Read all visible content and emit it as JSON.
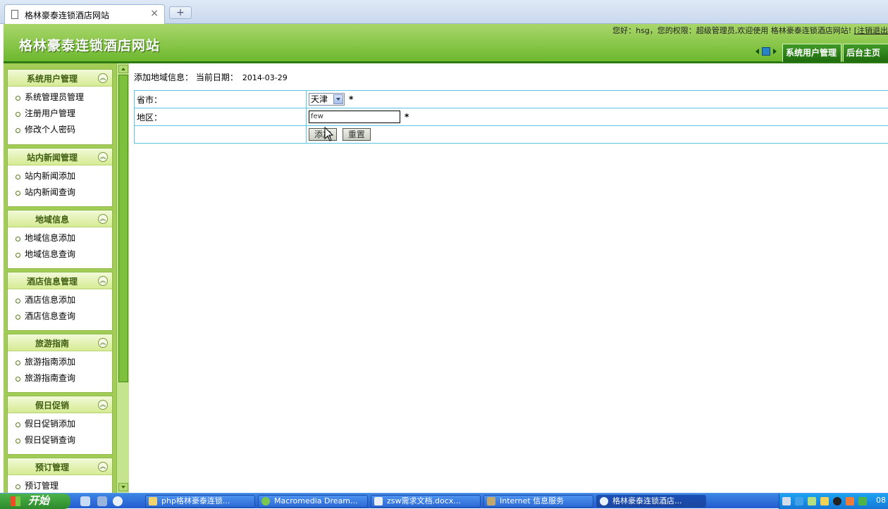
{
  "browser": {
    "tab_title": "格林豪泰连锁酒店网站",
    "close_glyph": "×",
    "new_tab_glyph": "+"
  },
  "header": {
    "site_title": "格林豪泰连锁酒店网站",
    "greeting": "您好：hsg，您的权限：超级管理员,欢迎使用 格林豪泰连锁酒店网站!",
    "logout": "[注销退出",
    "nav_tabs": [
      "系统用户管理",
      "后台主页"
    ]
  },
  "sidebar": {
    "panels": [
      {
        "title": "系统用户管理",
        "items": [
          "系统管理员管理",
          "注册用户管理",
          "修改个人密码"
        ]
      },
      {
        "title": "站内新闻管理",
        "items": [
          "站内新闻添加",
          "站内新闻查询"
        ]
      },
      {
        "title": "地域信息",
        "items": [
          "地域信息添加",
          "地域信息查询"
        ]
      },
      {
        "title": "酒店信息管理",
        "items": [
          "酒店信息添加",
          "酒店信息查询"
        ]
      },
      {
        "title": "旅游指南",
        "items": [
          "旅游指南添加",
          "旅游指南查询"
        ]
      },
      {
        "title": "假日促销",
        "items": [
          "假日促销添加",
          "假日促销查询"
        ]
      },
      {
        "title": "预订管理",
        "items": [
          "预订管理"
        ]
      }
    ],
    "collapse_glyph": "︽"
  },
  "main": {
    "info_label": "添加地域信息： 当前日期：",
    "date": "2014-03-29",
    "form": {
      "province_label": "省市：",
      "province_value": "天津",
      "region_label": "地区：",
      "region_value": "few",
      "required_mark": "*",
      "submit_label": "添加",
      "reset_label": "重置"
    }
  },
  "taskbar": {
    "start_label": "开始",
    "tasks": [
      "php格林豪泰连锁...",
      "Macromedia Dream...",
      "zsw需求文档.docx...",
      "Internet 信息服务",
      "格林豪泰连锁酒店..."
    ],
    "clock": "08"
  }
}
